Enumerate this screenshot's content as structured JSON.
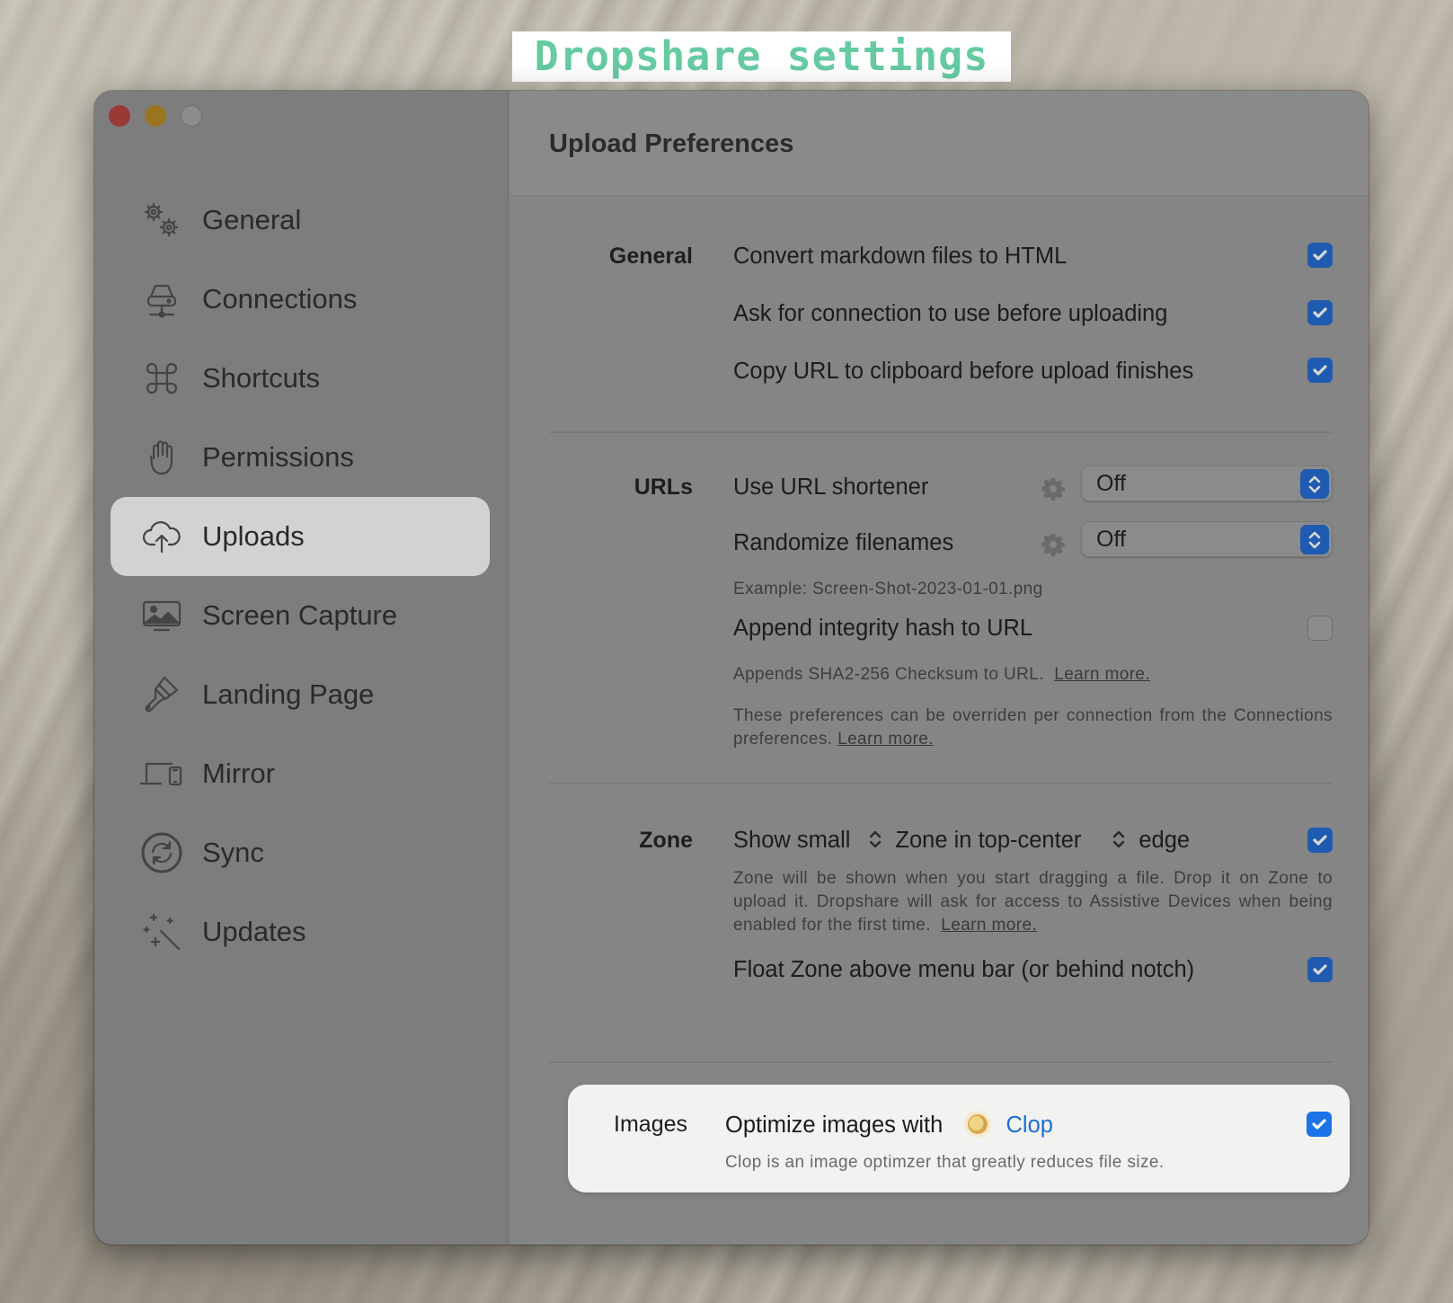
{
  "caption": "Dropshare settings",
  "window": {
    "title": "Upload Preferences"
  },
  "sidebar": {
    "items": [
      {
        "label": "General",
        "icon": "gears-icon",
        "active": false
      },
      {
        "label": "Connections",
        "icon": "server-network-icon",
        "active": false
      },
      {
        "label": "Shortcuts",
        "icon": "command-key-icon",
        "active": false
      },
      {
        "label": "Permissions",
        "icon": "hand-raised-icon",
        "active": false
      },
      {
        "label": "Uploads",
        "icon": "cloud-upload-icon",
        "active": true
      },
      {
        "label": "Screen Capture",
        "icon": "photo-monitor-icon",
        "active": false
      },
      {
        "label": "Landing Page",
        "icon": "paintbrush-icon",
        "active": false
      },
      {
        "label": "Mirror",
        "icon": "laptop-phone-icon",
        "active": false
      },
      {
        "label": "Sync",
        "icon": "sync-circle-icon",
        "active": false
      },
      {
        "label": "Updates",
        "icon": "magic-wand-sparkles-icon",
        "active": false
      }
    ]
  },
  "sections": {
    "general": {
      "label": "General",
      "options": [
        {
          "label": "Convert markdown files to HTML",
          "checked": true
        },
        {
          "label": "Ask for connection to use before uploading",
          "checked": true
        },
        {
          "label": "Copy URL to clipboard before upload finishes",
          "checked": true
        }
      ]
    },
    "urls": {
      "label": "URLs",
      "url_shortener": {
        "label": "Use URL shortener",
        "value": "Off"
      },
      "randomize": {
        "label": "Randomize filenames",
        "value": "Off"
      },
      "example": "Example: Screen-Shot-2023-01-01.png",
      "integrity": {
        "label": "Append integrity hash to URL",
        "checked": false
      },
      "integrity_desc": "Appends SHA2-256 Checksum to URL.",
      "learn_more": "Learn more.",
      "override_note": "These preferences can be overriden per connection from the Connections preferences.",
      "override_learn_more": "Learn more."
    },
    "zone": {
      "label": "Zone",
      "show": "Show",
      "size_value": "small",
      "zone_in": "Zone in",
      "position_value": "top-center",
      "edge": "edge",
      "enabled": true,
      "description": "Zone will be shown when you start dragging a file. Drop it on Zone to upload it. Dropshare will ask for access to Assistive Devices when being enabled for the first time.",
      "learn_more": "Learn more.",
      "float": {
        "label": "Float Zone above menu bar (or behind notch)",
        "checked": true
      }
    },
    "images": {
      "label": "Images",
      "optimize": "Optimize images with",
      "app_name": "Clop",
      "checked": true,
      "description": "Clop is an image optimzer that greatly reduces file size."
    }
  },
  "colors": {
    "checkbox_active": "#1f5bb0",
    "checkbox_highlight": "#1b73e8",
    "caption_text": "#66cba0",
    "link_blue": "#1a6fd6"
  }
}
